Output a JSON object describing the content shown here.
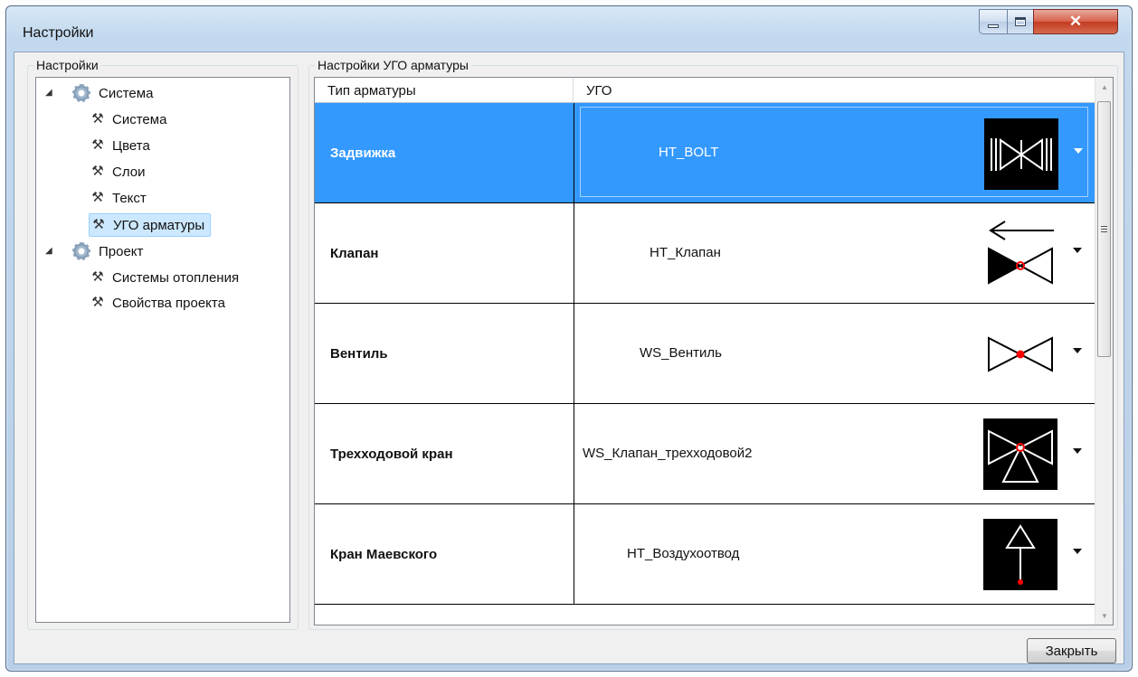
{
  "window": {
    "title": "Настройки"
  },
  "left_panel": {
    "legend": "Настройки",
    "tree": [
      {
        "label": "Система",
        "level": 0,
        "icon": "gear-icon",
        "expanded": true
      },
      {
        "label": "Система",
        "level": 1,
        "icon": "tools-icon"
      },
      {
        "label": "Цвета",
        "level": 1,
        "icon": "tools-icon"
      },
      {
        "label": "Слои",
        "level": 1,
        "icon": "tools-icon"
      },
      {
        "label": "Текст",
        "level": 1,
        "icon": "tools-icon"
      },
      {
        "label": "УГО арматуры",
        "level": 1,
        "icon": "tools-icon",
        "selected": true
      },
      {
        "label": "Проект",
        "level": 0,
        "icon": "gear-icon",
        "expanded": true
      },
      {
        "label": "Системы отопления",
        "level": 1,
        "icon": "tools-icon"
      },
      {
        "label": "Свойства проекта",
        "level": 1,
        "icon": "tools-icon"
      }
    ]
  },
  "right_panel": {
    "legend": "Настройки УГО арматуры",
    "columns": [
      "Тип арматуры",
      "УГО"
    ],
    "rows": [
      {
        "type": "Задвижка",
        "ugo": "HT_BOLT",
        "symbol": "gate-valve-symbol",
        "selected": true
      },
      {
        "type": "Клапан",
        "ugo": "HT_Клапан",
        "symbol": "check-valve-symbol"
      },
      {
        "type": "Вентиль",
        "ugo": "WS_Вентиль",
        "symbol": "globe-valve-symbol"
      },
      {
        "type": "Трехходовой кран",
        "ugo": "WS_Клапан_трехходовой2",
        "symbol": "three-way-valve-symbol"
      },
      {
        "type": "Кран Маевского",
        "ugo": "HT_Воздухоотвод",
        "symbol": "air-vent-symbol"
      }
    ]
  },
  "footer": {
    "close_label": "Закрыть"
  },
  "colors": {
    "selection": "#3399ff",
    "tree_selection": "#cce8ff",
    "symbol_accent": "#ff0000"
  }
}
